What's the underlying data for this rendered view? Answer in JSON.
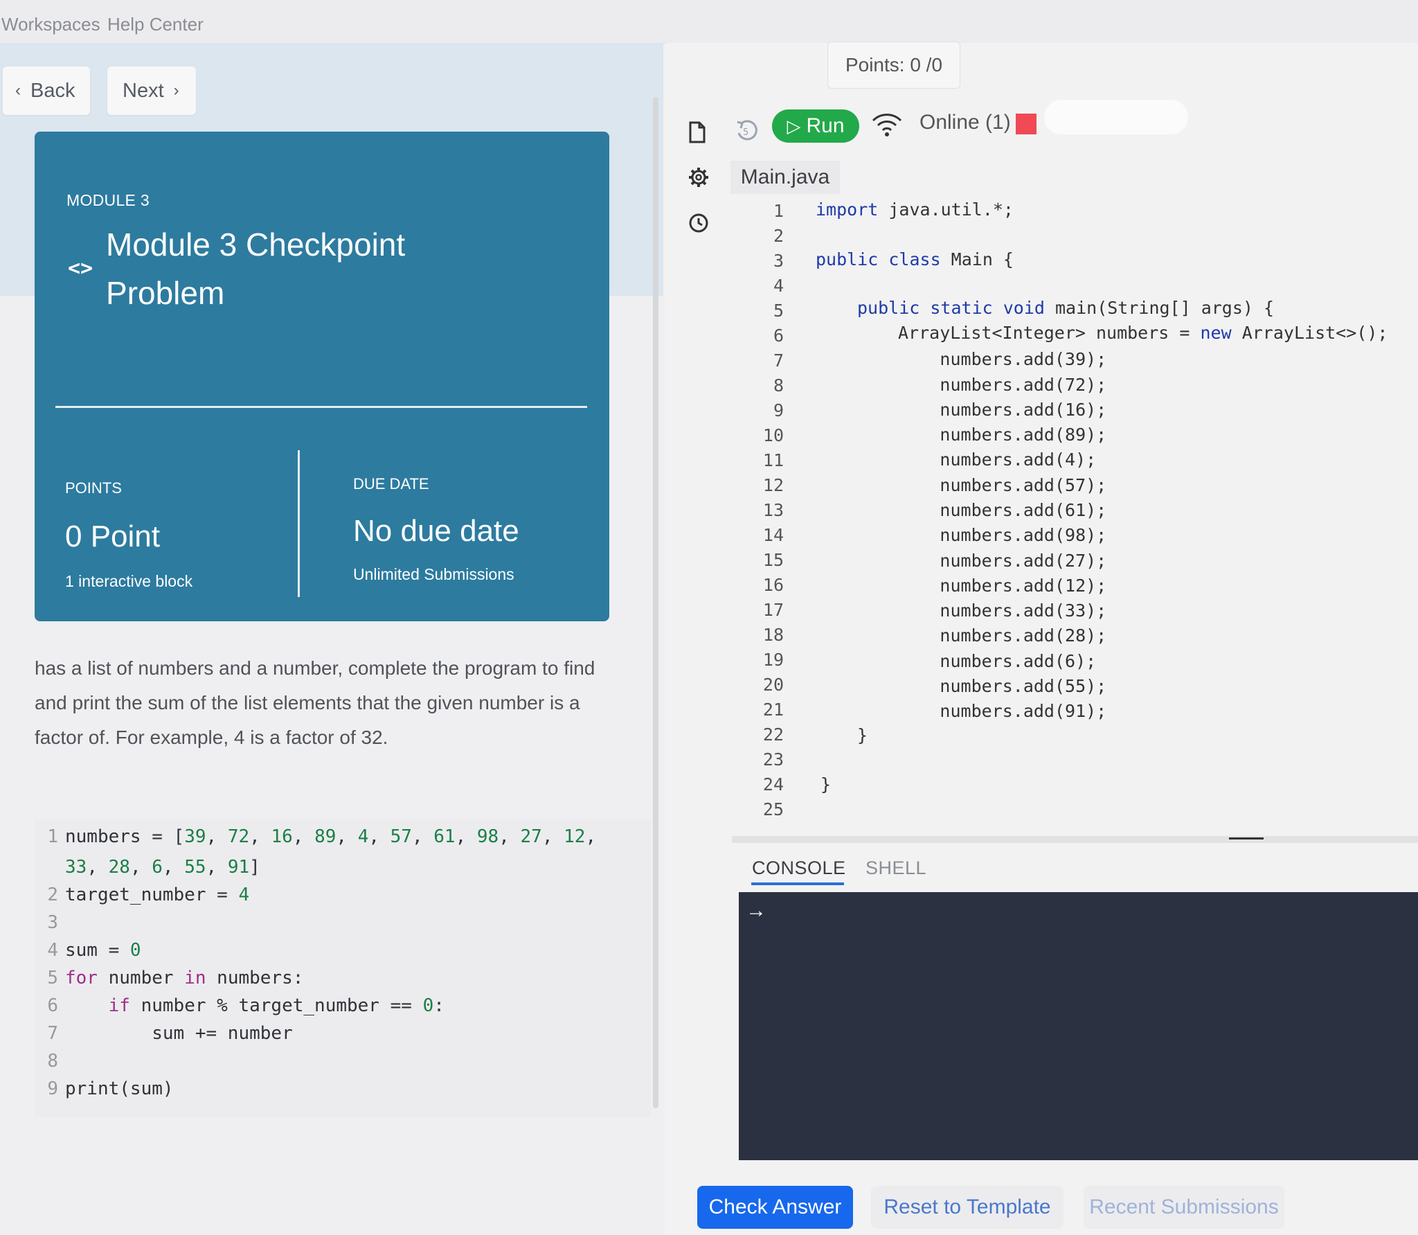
{
  "topnav": {
    "workspaces": "Workspaces",
    "help_center": "Help Center"
  },
  "nav": {
    "back_label": "Back",
    "next_label": "Next",
    "back_icon": "chevron-left-icon",
    "next_icon": "chevron-right-icon"
  },
  "card": {
    "module": "MODULE 3",
    "title": "Module 3 Checkpoint Problem",
    "icon": "code-brackets-icon",
    "points_label": "POINTS",
    "points_value": "0 Point",
    "points_sub": "1 interactive block",
    "due_label": "DUE DATE",
    "due_value": "No due date",
    "due_sub": "Unlimited Submissions",
    "color": "#2d7b9f"
  },
  "description": "has a list of numbers and a number, complete the program to find and print the sum of the list elements that the given number is a factor of. For example, 4 is a factor of 32.",
  "python_code": [
    {
      "n": "1",
      "text": "numbers = [39, 72, 16, 89, 4, 57, 61, 98, 27, 12,"
    },
    {
      "n": "",
      "text": "33, 28, 6, 55, 91]"
    },
    {
      "n": "2",
      "text": "target_number = 4"
    },
    {
      "n": "3",
      "text": ""
    },
    {
      "n": "4",
      "text": "sum = 0"
    },
    {
      "n": "5",
      "text": "for number in numbers:"
    },
    {
      "n": "6",
      "text": "    if number % target_number == 0:"
    },
    {
      "n": "7",
      "text": "        sum += number"
    },
    {
      "n": "8",
      "text": ""
    },
    {
      "n": "9",
      "text": "print(sum)"
    }
  ],
  "editor_header": {
    "points": "Points: 0 /0",
    "run_label": "Run",
    "online_label": "Online (1)",
    "file_tab": "Main.java",
    "status_color": "#ef4a55",
    "run_color": "#22a949"
  },
  "java_code": [
    {
      "n": "1",
      "text": "import java.util.*;"
    },
    {
      "n": "2",
      "text": ""
    },
    {
      "n": "3",
      "text": "public class Main {"
    },
    {
      "n": "4",
      "text": ""
    },
    {
      "n": "5",
      "text": "    public static void main(String[] args) {"
    },
    {
      "n": "6",
      "text": "        ArrayList<Integer> numbers = new ArrayList<>();"
    },
    {
      "n": "7",
      "text": "        numbers.add(39);"
    },
    {
      "n": "8",
      "text": "        numbers.add(72);"
    },
    {
      "n": "9",
      "text": "        numbers.add(16);"
    },
    {
      "n": "10",
      "text": "        numbers.add(89);"
    },
    {
      "n": "11",
      "text": "        numbers.add(4);"
    },
    {
      "n": "12",
      "text": "        numbers.add(57);"
    },
    {
      "n": "13",
      "text": "        numbers.add(61);"
    },
    {
      "n": "14",
      "text": "        numbers.add(98);"
    },
    {
      "n": "15",
      "text": "        numbers.add(27);"
    },
    {
      "n": "16",
      "text": "        numbers.add(12);"
    },
    {
      "n": "17",
      "text": "        numbers.add(33);"
    },
    {
      "n": "18",
      "text": "        numbers.add(28);"
    },
    {
      "n": "19",
      "text": "        numbers.add(6);"
    },
    {
      "n": "20",
      "text": "        numbers.add(55);"
    },
    {
      "n": "21",
      "text": "        numbers.add(91);"
    },
    {
      "n": "22",
      "text": "    }"
    },
    {
      "n": "23",
      "text": ""
    },
    {
      "n": "24",
      "text": "}"
    },
    {
      "n": "25",
      "text": ""
    }
  ],
  "console": {
    "tab_console": "CONSOLE",
    "tab_shell": "SHELL",
    "prompt": "→"
  },
  "actions": {
    "check_answer": "Check Answer",
    "reset": "Reset to Template",
    "recent": "Recent Submissions"
  }
}
